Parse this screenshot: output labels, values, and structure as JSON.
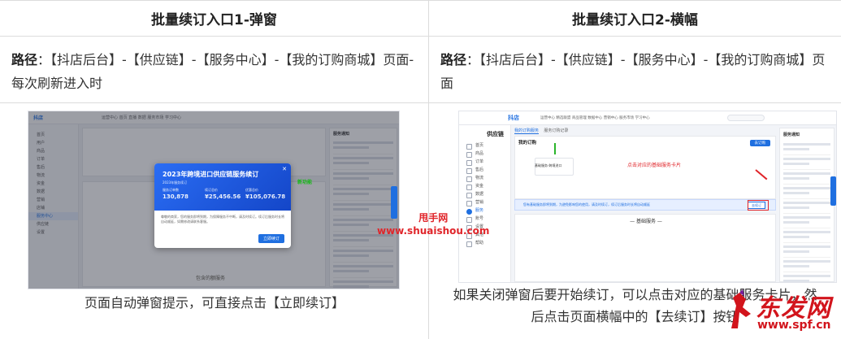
{
  "columns": [
    {
      "heading": "批量续订入口1-弹窗",
      "path_label": "路径",
      "path_text": "：【抖店后台】-【供应链】-【服务中心】-【我的订购商城】页面-每次刷新进入时",
      "caption": "页面自动弹窗提示，可直接点击【立即续订】",
      "screenshot": {
        "logo": "抖店",
        "topnav": "运营中心  首页  直播  数据  服务市场  学习中心",
        "sidebar": [
          "首页",
          "用户",
          "商品",
          "订单",
          "售后",
          "物流",
          "资金",
          "数据",
          "营销",
          "店铺",
          "服务中心",
          "供应链",
          "设置"
        ],
        "sidebar_active_index": 10,
        "modal_title": "2023年跨境进口供应链服务续订",
        "modal_sub": "2023年服务续订",
        "stats": [
          {
            "label": "服务订单数",
            "value": "130,878"
          },
          {
            "label": "续订总价",
            "value": "¥25,456.56"
          },
          {
            "label": "优惠总价",
            "value": "¥105,076.78"
          }
        ],
        "modal_body": "尊敬的商家，您的服务即将到期，为保障服务不中断，请及时续订。续订后服务时长将自动顺延，如需修改请联系客服。",
        "modal_button": "立即续订",
        "green_tag": "新功能",
        "bottom_text": "包含的额服务",
        "right_panel_title": "服务通知"
      }
    },
    {
      "heading": "批量续订入口2-横幅",
      "path_label": "路径",
      "path_text": "：【抖店后台】-【供应链】-【服务中心】-【我的订购商城】页面",
      "caption_lines": [
        "如果关闭弹窗后要开始续订，可以点击对应的基础服务卡片，然",
        "后点击页面横幅中的【去续订】按钮"
      ],
      "screenshot": {
        "logo": "抖店",
        "topnav": "运营中心  精选联盟  商品管理  数据中心  营销中心  服务市场  学习中心",
        "sidebar_title": "供应链",
        "sidebar": [
          "首页",
          "商品",
          "订单",
          "售后",
          "物流",
          "资金",
          "数据",
          "营销",
          "服务",
          "账号",
          "设置",
          "其他",
          "帮助"
        ],
        "sidebar_active_index": 8,
        "tabs": [
          "我的订购服务",
          "服务订购记录"
        ],
        "card_title": "我的订购",
        "service_label": "基础服务-跨境进口",
        "red_note": "点击对应的基础服务卡片",
        "banner_text": "您有基础服务即将到期，为避免影响您的使用，请及时续订，续订后服务时长将自动顺延",
        "banner_button": "去续订",
        "order_button": "去订购",
        "basic_title": "— 基础服务 —",
        "right_panel_title": "服务通知"
      }
    }
  ],
  "watermarks": {
    "site_cn": "甩手网",
    "site_url": "www.shuaishou.com",
    "brand": "东发网",
    "brand_url": "www.spf.cn"
  },
  "colors": {
    "accent": "#1f6fe0",
    "highlight_red": "#e0252a",
    "highlight_green": "#16b816"
  }
}
